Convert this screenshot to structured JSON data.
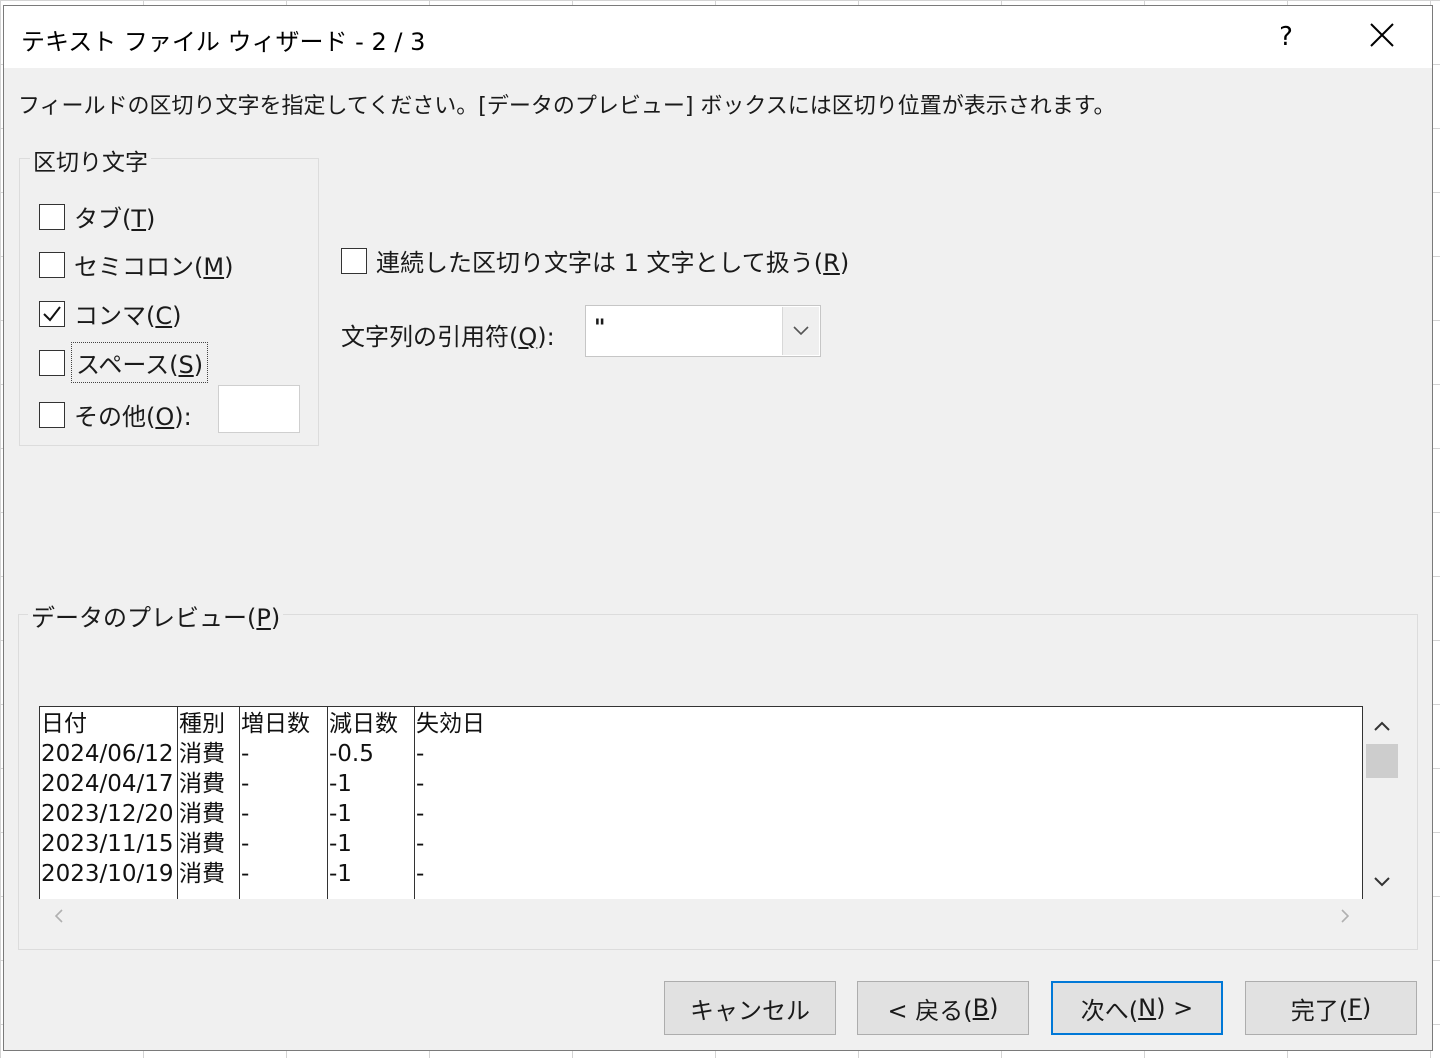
{
  "dialog": {
    "title": "テキスト ファイル ウィザード - 2 / 3",
    "help_label": "?",
    "instruction": "フィールドの区切り文字を指定してください。[データのプレビュー] ボックスには区切り位置が表示されます。"
  },
  "delimiters": {
    "group_label": "区切り文字",
    "items": [
      {
        "label": "タブ(",
        "key": "T",
        "suffix": ")",
        "checked": false
      },
      {
        "label": "セミコロン(",
        "key": "M",
        "suffix": ")",
        "checked": false
      },
      {
        "label": "コンマ(",
        "key": "C",
        "suffix": ")",
        "checked": true
      },
      {
        "label": "スペース(",
        "key": "S",
        "suffix": ")",
        "checked": false
      },
      {
        "label": "その他(",
        "key": "O",
        "suffix": "):",
        "checked": false
      }
    ],
    "other_value": ""
  },
  "consecutive": {
    "label": "連続した区切り文字は 1 文字として扱う(",
    "key": "R",
    "suffix": ")",
    "checked": false
  },
  "text_qualifier": {
    "label": "文字列の引用符(",
    "key": "Q",
    "suffix": "):",
    "value": "\""
  },
  "preview": {
    "label": "データのプレビュー(",
    "key": "P",
    "suffix": ")",
    "columns": [
      [
        "日付",
        "2024/06/12",
        "2024/04/17",
        "2023/12/20",
        "2023/11/15",
        "2023/10/19"
      ],
      [
        "種別",
        "消費",
        "消費",
        "消費",
        "消費",
        "消費"
      ],
      [
        "増日数",
        "-",
        "-",
        "-",
        "-",
        "-"
      ],
      [
        "減日数",
        "-0.5",
        "-1",
        "-1",
        "-1",
        "-1"
      ],
      [
        "失効日",
        "-",
        "-",
        "-",
        "-",
        "-"
      ]
    ]
  },
  "buttons": {
    "cancel": "キャンセル",
    "back_prefix": "< 戻る(",
    "back_key": "B",
    "back_suffix": ")",
    "next_prefix": "次へ(",
    "next_key": "N",
    "next_suffix": ") >",
    "finish_prefix": "完了(",
    "finish_key": "F",
    "finish_suffix": ")"
  }
}
